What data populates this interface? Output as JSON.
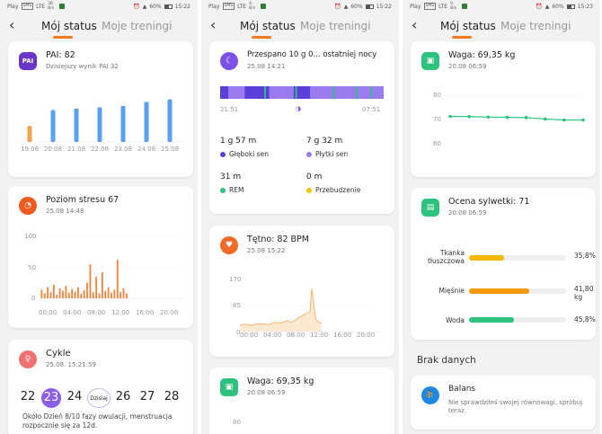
{
  "status_bar": [
    {
      "left": "Play",
      "chip1": "SMS",
      "chip2": "LTE",
      "speed": "36 B/s",
      "battery": "60%",
      "time": "15:22"
    },
    {
      "left": "Play",
      "chip1": "SMS",
      "chip2": "LTE",
      "speed": "4 B/s",
      "battery": "60%",
      "time": "15:22"
    },
    {
      "left": "Play",
      "chip1": "SMS",
      "chip2": "LTE",
      "speed": "0 B/s",
      "battery": "60%",
      "time": "15:23"
    }
  ],
  "tabs": {
    "status": "Mój status",
    "trainings": "Moje treningi"
  },
  "colors": {
    "accent": "#f07c22",
    "pai": "#6a35c9",
    "stress": "#f05a1e",
    "cycle": "#f07070",
    "sleep": "#7a52e8",
    "heart": "#f06a2a",
    "weight": "#2ec27e",
    "balance": "#1e88e5"
  },
  "pai": {
    "icon": "PAI",
    "title": "PAI: 82",
    "subtitle": "Dzisiejszy wynik PAI 32",
    "days": [
      "19.08",
      "20.08",
      "21.08",
      "22.08",
      "23.08",
      "24.08",
      "25.08"
    ]
  },
  "stress": {
    "title": "Poziom stresu 67",
    "date": "25.08 14:48",
    "yticks": [
      "100",
      "50",
      "0"
    ],
    "xticks": [
      "00:00",
      "04:00",
      "08:00",
      "12:00",
      "16:00",
      "20:00"
    ]
  },
  "cycle": {
    "title": "Cykle",
    "date": "25.08. 15:21:59",
    "days": [
      "22",
      "23",
      "24",
      "Dzisiaj",
      "26",
      "27",
      "28"
    ],
    "note": "Około Dzień 8/10 fazy owulacji, menstruacja rozpocznie się za 12d."
  },
  "sleep": {
    "title": "Przespano 10 g 0... ostatniej nocy",
    "date": "25.08 14:21",
    "start": "21:51",
    "end": "07:51",
    "stats": [
      {
        "value": "1 g 57 m",
        "label": "Głęboki sen",
        "color": "#5b3fd9"
      },
      {
        "value": "7 g 32 m",
        "label": "Płytki sen",
        "color": "#9a7cf0"
      },
      {
        "value": "31 m",
        "label": "REM",
        "color": "#2ec27e"
      },
      {
        "value": "0 m",
        "label": "Przebudzenie",
        "color": "#f5c400"
      }
    ]
  },
  "heart": {
    "title": "Tętno: 82 BPM",
    "date": "25.08 15:22",
    "yticks": [
      "170",
      "85",
      "0"
    ],
    "xticks": [
      "00:00",
      "04:00",
      "08:00",
      "12:00",
      "16:00",
      "20:00"
    ]
  },
  "weight": {
    "title": "Waga: 69,35 kg",
    "date": "20.08 06:59",
    "yticks": [
      "80",
      "70",
      "60"
    ],
    "peek_ytick": "80"
  },
  "body": {
    "title": "Ocena sylwetki: 71",
    "date": "20.08 06:59",
    "bars": [
      {
        "label": "Tkanka tłuszczowa",
        "value": "35,8%",
        "fraction": 0.36,
        "color": "#f5b800"
      },
      {
        "label": "Mięśnie",
        "value": "41,80 kg",
        "fraction": 0.62,
        "color": "#f59a00"
      },
      {
        "label": "Woda",
        "value": "45,8%",
        "fraction": 0.46,
        "color": "#2ec27e"
      }
    ]
  },
  "no_data": {
    "title": "Brak danych"
  },
  "balance": {
    "title": "Balans",
    "text": "Nie sprawdziłeś swojej równowagi, spróbuj teraz"
  },
  "chart_data": [
    {
      "type": "bar",
      "categories": [
        "19.08",
        "20.08",
        "21.08",
        "22.08",
        "23.08",
        "24.08",
        "25.08"
      ],
      "values": [
        12,
        24,
        25,
        26,
        27,
        30,
        32
      ],
      "highlight_index": 0
    },
    {
      "type": "bar",
      "xlim": [
        0,
        24
      ],
      "ylim": [
        0,
        100
      ],
      "hours": [
        0.5,
        1,
        1.5,
        2,
        2.5,
        3,
        3.5,
        4,
        4.5,
        5,
        5.5,
        6,
        6.5,
        7,
        7.5,
        8,
        8.5,
        9,
        9.5,
        10,
        10.5,
        11,
        11.5,
        12,
        12.5,
        13,
        13.5,
        14,
        14.5
      ],
      "values": [
        14,
        8,
        18,
        10,
        22,
        6,
        16,
        12,
        20,
        9,
        15,
        11,
        18,
        7,
        13,
        25,
        55,
        10,
        35,
        8,
        42,
        12,
        18,
        9,
        14,
        62,
        10,
        16,
        8
      ]
    },
    {
      "type": "line",
      "xlim": [
        0,
        24
      ],
      "ylim": [
        0,
        170
      ],
      "x": [
        0,
        1,
        2,
        3,
        4,
        5,
        6,
        7,
        8,
        9,
        10,
        11,
        11.5,
        12,
        12.3,
        12.6,
        13,
        13.5,
        14
      ],
      "y": [
        22,
        24,
        20,
        26,
        25,
        23,
        30,
        28,
        35,
        30,
        45,
        55,
        60,
        65,
        140,
        95,
        40,
        30,
        28
      ]
    },
    {
      "type": "line",
      "ylim": [
        60,
        80
      ],
      "values": [
        71.3,
        71.2,
        71.0,
        70.9,
        70.8,
        70.2,
        69.8,
        69.8
      ],
      "start_date": "",
      "end_date": ""
    }
  ],
  "sleep_stages": {
    "deep": [
      [
        0,
        5
      ],
      [
        15,
        30
      ],
      [
        45,
        55
      ]
    ],
    "rem": [
      [
        27,
        28
      ],
      [
        46,
        47
      ],
      [
        69,
        70
      ],
      [
        83,
        84
      ],
      [
        92,
        93
      ]
    ]
  }
}
